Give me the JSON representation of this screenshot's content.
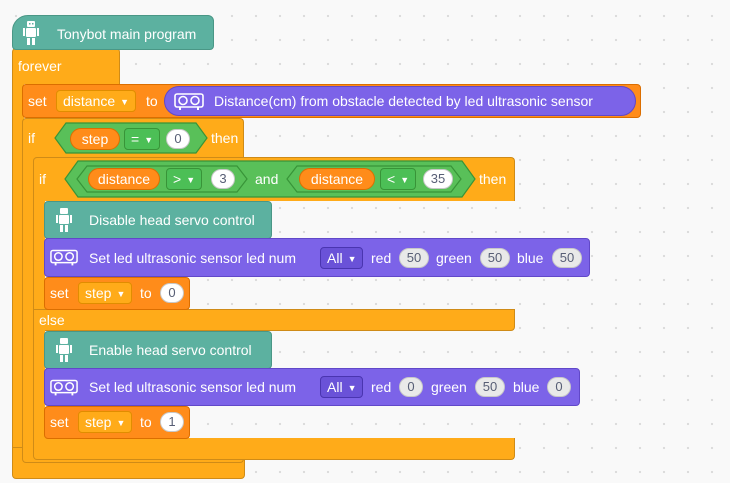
{
  "program": {
    "hat_label": "Tonybot main program",
    "forever_label": "forever",
    "set_distance": {
      "set_label": "set",
      "variable": "distance",
      "to_label": "to",
      "sensor_label": "Distance(cm) from obstacle detected by led ultrasonic sensor"
    },
    "if_outer": {
      "if_label": "if",
      "variable": "step",
      "operator": "=",
      "value": "0",
      "then_label": "then"
    },
    "if_inner": {
      "if_label": "if",
      "left_variable": "distance",
      "left_operator": ">",
      "left_value": "3",
      "and_label": "and",
      "right_variable": "distance",
      "right_operator": "<",
      "right_value": "35",
      "then_label": "then",
      "else_label": "else"
    },
    "then_branch": {
      "servo_label": "Disable head servo control",
      "led": {
        "label": "Set led ultrasonic sensor led num",
        "num": "All",
        "red_label": "red",
        "red": "50",
        "green_label": "green",
        "green": "50",
        "blue_label": "blue",
        "blue": "50"
      },
      "set_step": {
        "set_label": "set",
        "variable": "step",
        "to_label": "to",
        "value": "0"
      }
    },
    "else_branch": {
      "servo_label": "Enable head servo control",
      "led": {
        "label": "Set led ultrasonic sensor led num",
        "num": "All",
        "red_label": "red",
        "red": "0",
        "green_label": "green",
        "green": "50",
        "blue_label": "blue",
        "blue": "0"
      },
      "set_step": {
        "set_label": "set",
        "variable": "step",
        "to_label": "to",
        "value": "1"
      }
    }
  },
  "colors": {
    "control": "#ffab19",
    "variables": "#ff8c1a",
    "operators": "#59c059",
    "tonybot": "#5cb1a0",
    "sensor": "#7c63e8"
  },
  "icons": {
    "robot": "robot-icon",
    "sensor": "ultrasonic-sensor-icon"
  }
}
